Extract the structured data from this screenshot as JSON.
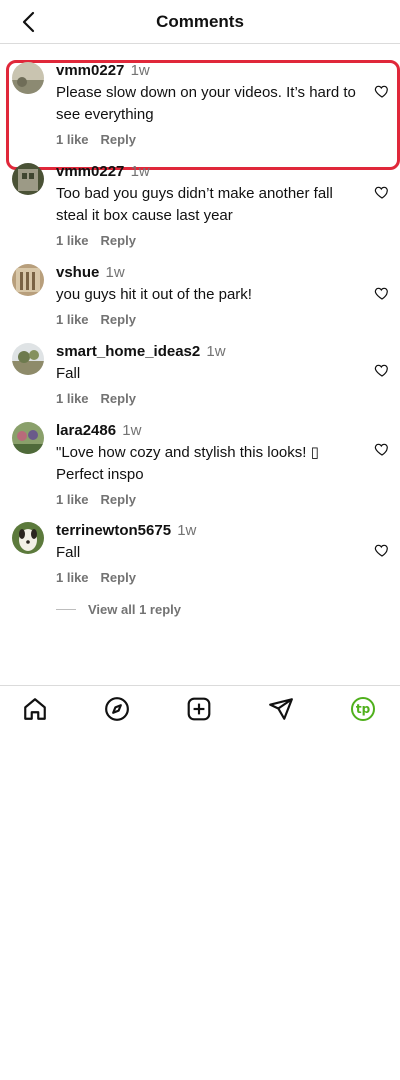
{
  "header": {
    "title": "Comments"
  },
  "comments": [
    {
      "username": "vmm0227",
      "time": "1w",
      "text": "Please slow down on your videos. It’s hard to see everything",
      "likes": "1 like",
      "reply": "Reply"
    },
    {
      "username": "vmm0227",
      "time": "1w",
      "text": "Too bad you guys didn’t make another fall steal it box cause last year",
      "likes": "1 like",
      "reply": "Reply"
    },
    {
      "username": "vshue",
      "time": "1w",
      "text": "you guys hit it out of the park!",
      "likes": "1 like",
      "reply": "Reply"
    },
    {
      "username": "smart_home_ideas2",
      "time": "1w",
      "text": "Fall",
      "likes": "1 like",
      "reply": "Reply"
    },
    {
      "username": "lara2486",
      "time": "1w",
      "text": "\"Love how cozy and stylish this looks! ▯ Perfect inspo",
      "likes": "1 like",
      "reply": "Reply"
    },
    {
      "username": "terrinewton5675",
      "time": "1w",
      "text": "Fall",
      "likes": "1 like",
      "reply": "Reply"
    }
  ],
  "view_replies": "View all 1 reply",
  "colors": {
    "highlight": "#e0283a",
    "accent_green": "#4fb01c",
    "muted": "#737373"
  },
  "profile_initials": "tp"
}
